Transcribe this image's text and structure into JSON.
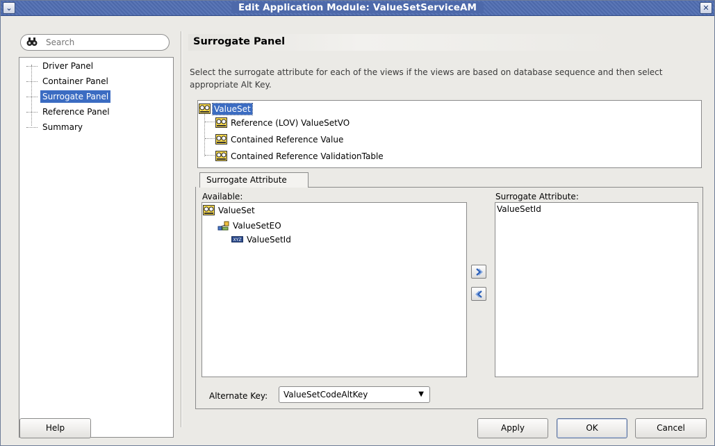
{
  "window": {
    "title": "Edit Application Module: ValueSetServiceAM"
  },
  "titlebar": {
    "menu_icon": "chevron-down-icon",
    "close_icon": "close-icon"
  },
  "search": {
    "placeholder": "Search"
  },
  "nav": {
    "items": [
      {
        "label": "Driver Panel",
        "selected": false
      },
      {
        "label": "Container Panel",
        "selected": false
      },
      {
        "label": "Surrogate Panel",
        "selected": true
      },
      {
        "label": "Reference Panel",
        "selected": false
      },
      {
        "label": "Summary",
        "selected": false
      }
    ]
  },
  "panel": {
    "title": "Surrogate Panel",
    "description": "Select the surrogate attribute for each of the views if the views are based on database sequence and then select appropriate Alt Key."
  },
  "view_tree": {
    "root": "ValueSet",
    "children": [
      "Reference (LOV) ValueSetVO",
      "Contained Reference Value",
      "Contained Reference ValidationTable"
    ]
  },
  "tab": {
    "label": "Surrogate Attribute"
  },
  "available": {
    "label": "Available:",
    "root": "ValueSet",
    "entity": "ValueSetEO",
    "attribute": "ValueSetId"
  },
  "surrogate": {
    "label": "Surrogate Attribute:",
    "items": [
      "ValueSetId"
    ]
  },
  "alternate_key": {
    "label": "Alternate Key:",
    "value": "ValueSetCodeAltKey"
  },
  "buttons": {
    "help": "Help",
    "apply": "Apply",
    "ok": "OK",
    "cancel": "Cancel"
  }
}
